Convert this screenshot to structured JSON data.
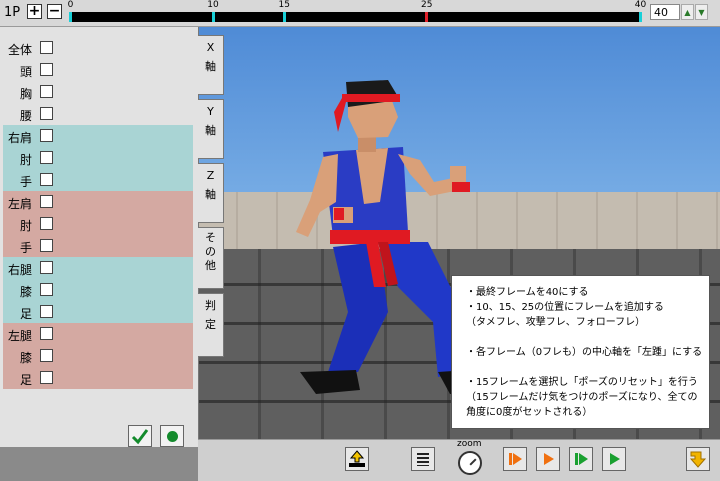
{
  "topbar": {
    "player": "1P",
    "plus": "+",
    "minus": "−",
    "frame_value": "40",
    "ticks": [
      {
        "label": "0",
        "frame": 0,
        "color": "#19d0d8"
      },
      {
        "label": "10",
        "frame": 10,
        "color": "#19d0d8"
      },
      {
        "label": "15",
        "frame": 15,
        "color": "#19d0d8"
      },
      {
        "label": "25",
        "frame": 25,
        "color": "#e0202a"
      },
      {
        "label": "40",
        "frame": 40,
        "color": "#19d0d8"
      }
    ],
    "max_frame": 40
  },
  "panel": {
    "parts": [
      {
        "label": "全体",
        "group": "none"
      },
      {
        "label": "頭",
        "group": "none"
      },
      {
        "label": "胸",
        "group": "none"
      },
      {
        "label": "腰",
        "group": "none"
      },
      {
        "label": "右肩",
        "group": "teal"
      },
      {
        "label": "肘",
        "group": "teal"
      },
      {
        "label": "手",
        "group": "teal"
      },
      {
        "label": "左肩",
        "group": "pink"
      },
      {
        "label": "肘",
        "group": "pink"
      },
      {
        "label": "手",
        "group": "pink"
      },
      {
        "label": "右腿",
        "group": "teal"
      },
      {
        "label": "膝",
        "group": "teal"
      },
      {
        "label": "足",
        "group": "teal"
      },
      {
        "label": "左腿",
        "group": "pink"
      },
      {
        "label": "膝",
        "group": "pink"
      },
      {
        "label": "足",
        "group": "pink"
      }
    ]
  },
  "tabs": [
    {
      "line1": "X",
      "line2": "軸"
    },
    {
      "line1": "Y",
      "line2": "軸"
    },
    {
      "line1": "Z",
      "line2": "軸"
    },
    {
      "line1": "そ",
      "line2": "の",
      "line3": "他"
    },
    {
      "line1": "判",
      "line2": "定"
    }
  ],
  "info": {
    "lines": [
      "・最終フレームを40にする",
      "・10、15、25の位置にフレームを追加する",
      "（タメフレ、攻撃フレ、フォローフレ）",
      "",
      "・各フレーム（0フレも）の中心軸を「左踵」にする",
      "",
      "・15フレームを選択し「ポーズのリセット」を行う",
      "（15フレームだけ気をつけのポーズになり、全ての",
      "角度に0度がセットされる）"
    ]
  },
  "bottombar": {
    "zoom_label": "zoom"
  },
  "colors": {
    "teal_group": "#a9d4d4",
    "pink_group": "#d4a9a2",
    "play_orange": "#f07010",
    "play_green": "#1aa030"
  }
}
